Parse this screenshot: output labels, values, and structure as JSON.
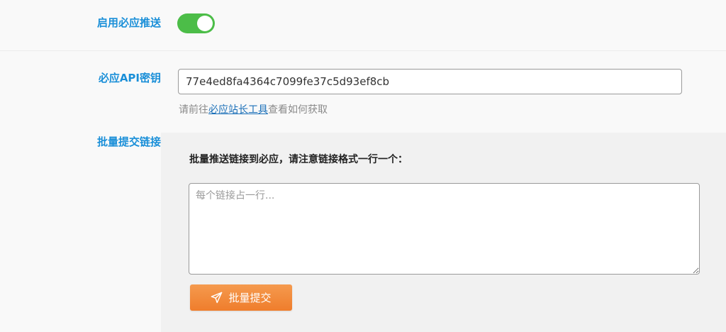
{
  "colors": {
    "label": "#1a8fd8",
    "toggle_on": "#4cbd48",
    "link": "#1a6fb8",
    "button": "#ef7d2c"
  },
  "enable_push": {
    "label": "启用必应推送",
    "enabled": true
  },
  "api_key": {
    "label": "必应API密钥",
    "value": "77e4ed8fa4364c7099fe37c5d93ef8cb",
    "hint_prefix": "请前往",
    "hint_link": "必应站长工具",
    "hint_suffix": "查看如何获取"
  },
  "batch": {
    "label": "批量提交链接",
    "title": "批量推送链接到必应，请注意链接格式一行一个：",
    "placeholder": "每个链接占一行...",
    "value": "",
    "button_label": "批量提交",
    "button_icon": "send-icon"
  }
}
